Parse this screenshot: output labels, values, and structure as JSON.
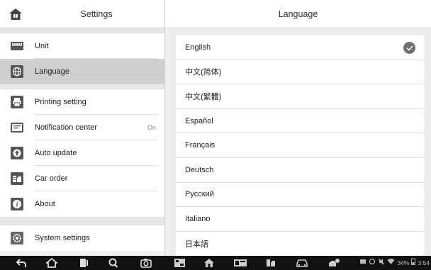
{
  "header": {
    "left_title": "Settings",
    "right_title": "Language"
  },
  "sidebar": {
    "groups": [
      [
        {
          "label": "Unit",
          "icon": "ruler-icon"
        },
        {
          "label": "Language",
          "icon": "globe-icon",
          "active": true
        }
      ],
      [
        {
          "label": "Printing setting",
          "icon": "printer-icon"
        },
        {
          "label": "Notification center",
          "icon": "notification-icon",
          "value": "On"
        },
        {
          "label": "Auto update",
          "icon": "update-icon"
        },
        {
          "label": "Car order",
          "icon": "car-order-icon"
        },
        {
          "label": "About",
          "icon": "info-icon"
        }
      ],
      [
        {
          "label": "System settings",
          "icon": "system-gear-icon"
        }
      ]
    ]
  },
  "languages": {
    "items": [
      "English",
      "中文(简体)",
      "中文(繁體)",
      "Español",
      "Français",
      "Deutsch",
      "Русский",
      "Italiano",
      "日本語"
    ],
    "selected": "English"
  },
  "statusbar": {
    "battery": "34%",
    "time": "3:54"
  },
  "colors": {
    "active_row": "#cfcfcf",
    "check_badge": "#6f6f6f",
    "navbar": "#111111"
  }
}
